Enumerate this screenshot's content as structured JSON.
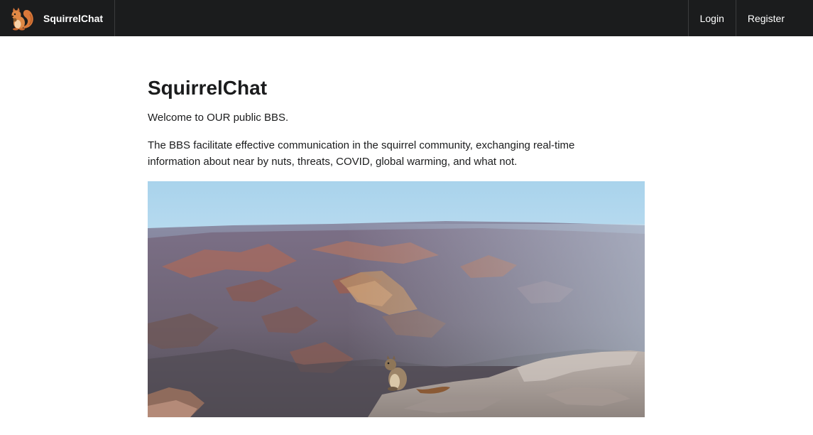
{
  "navbar": {
    "brand": {
      "label": "SquirrelChat",
      "logo_icon": "squirrel-icon"
    },
    "links": [
      {
        "label": "Login"
      },
      {
        "label": "Register"
      }
    ]
  },
  "main": {
    "title": "SquirrelChat",
    "welcome": "Welcome to OUR public BBS.",
    "description": "The BBS facilitate effective communication in the squirrel community, exchanging real-time information about near by nuts, threats, COVID, global warming, and what not."
  },
  "colors": {
    "navbar_bg": "#1b1c1d",
    "squirrel_orange": "#d9783a"
  }
}
